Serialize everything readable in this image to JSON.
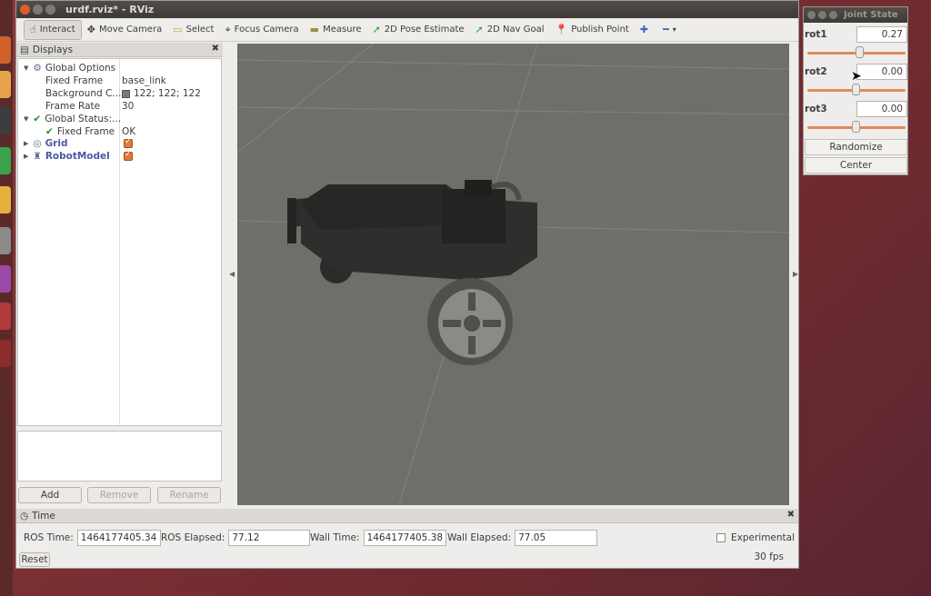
{
  "window": {
    "title": "urdf.rviz* - RViz"
  },
  "toolbar": {
    "items": [
      {
        "label": "Interact",
        "icon": "hand-icon",
        "active": true
      },
      {
        "label": "Move Camera",
        "icon": "move-camera-icon",
        "active": false
      },
      {
        "label": "Select",
        "icon": "select-icon",
        "active": false
      },
      {
        "label": "Focus Camera",
        "icon": "focus-camera-icon",
        "active": false
      },
      {
        "label": "Measure",
        "icon": "ruler-icon",
        "active": false
      },
      {
        "label": "2D Pose Estimate",
        "icon": "pose-arrow-icon",
        "active": false
      },
      {
        "label": "2D Nav Goal",
        "icon": "nav-arrow-icon",
        "active": false
      },
      {
        "label": "Publish Point",
        "icon": "map-pin-icon",
        "active": false
      }
    ]
  },
  "displays": {
    "title": "Displays",
    "rows": [
      {
        "name": "Global Options",
        "value": ""
      },
      {
        "name": "Fixed Frame",
        "value": "base_link"
      },
      {
        "name": "Background C...",
        "value": "122; 122; 122"
      },
      {
        "name": "Frame Rate",
        "value": "30"
      },
      {
        "name": "Global Status:...",
        "value": ""
      },
      {
        "name": "Fixed Frame",
        "value": "OK"
      },
      {
        "name": "Grid",
        "value": ""
      },
      {
        "name": "RobotModel",
        "value": ""
      }
    ],
    "buttons": {
      "add": "Add",
      "remove": "Remove",
      "rename": "Rename"
    }
  },
  "time": {
    "title": "Time",
    "ros_time_label": "ROS Time:",
    "ros_time": "1464177405.34",
    "ros_elapsed_label": "ROS Elapsed:",
    "ros_elapsed": "77.12",
    "wall_time_label": "Wall Time:",
    "wall_time": "1464177405.38",
    "wall_elapsed_label": "Wall Elapsed:",
    "wall_elapsed": "77.05",
    "experimental_label": "Experimental",
    "reset_label": "Reset",
    "fps": "30 fps"
  },
  "joint_state": {
    "title": "Joint State",
    "joints": [
      {
        "name": "rot1",
        "value": "0.27"
      },
      {
        "name": "rot2",
        "value": "0.00"
      },
      {
        "name": "rot3",
        "value": "0.00"
      }
    ],
    "randomize_label": "Randomize",
    "center_label": "Center"
  },
  "colors": {
    "background": "#7a7a7a",
    "accent": "#e07a3a"
  }
}
